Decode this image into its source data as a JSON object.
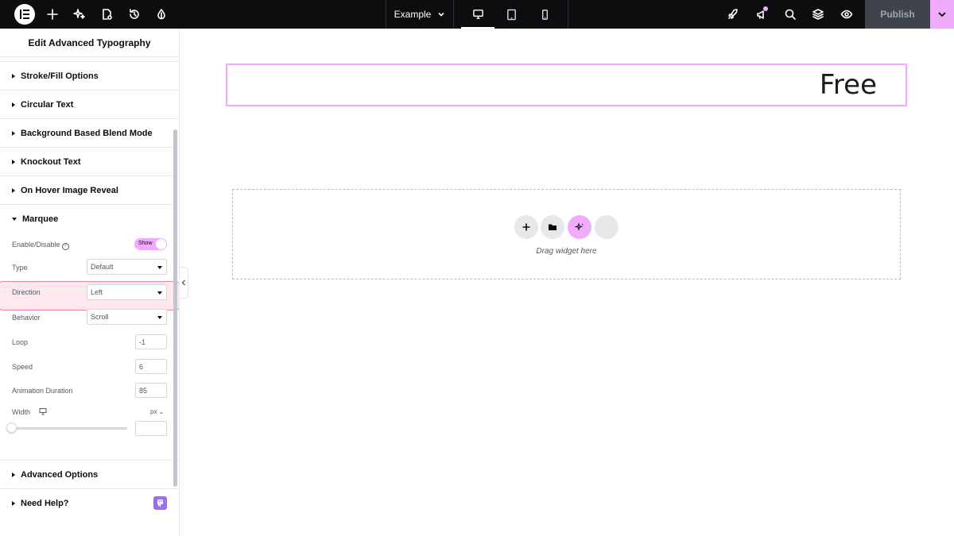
{
  "topbar": {
    "logo": "elementor-logo-icon",
    "document_title": "Example",
    "publish_label": "Publish",
    "accent": "#f0abfc"
  },
  "panel": {
    "title": "Edit Advanced Typography",
    "sections_before": [
      {
        "label": "Stroke/Fill Options"
      },
      {
        "label": "Circular Text"
      },
      {
        "label": "Background Based Blend Mode"
      },
      {
        "label": "Knockout Text"
      },
      {
        "label": "On Hover Image Reveal"
      }
    ],
    "marquee": {
      "label": "Marquee",
      "enable_label": "Enable/Disable",
      "enable_state": "Show",
      "type_label": "Type",
      "type_value": "Default",
      "direction_label": "Direction",
      "direction_value": "Left",
      "behavior_label": "Behavior",
      "behavior_value": "Scroll",
      "loop_label": "Loop",
      "loop_value": "-1",
      "speed_label": "Speed",
      "speed_value": "6",
      "duration_label": "Animation Duration",
      "duration_value": "85",
      "width_label": "Width",
      "width_unit": "px",
      "width_value": ""
    },
    "sections_after": [
      {
        "label": "Advanced Options"
      },
      {
        "label": "Need Help?"
      }
    ]
  },
  "canvas": {
    "widget_text": "Free",
    "dropzone_label": "Drag widget here"
  }
}
